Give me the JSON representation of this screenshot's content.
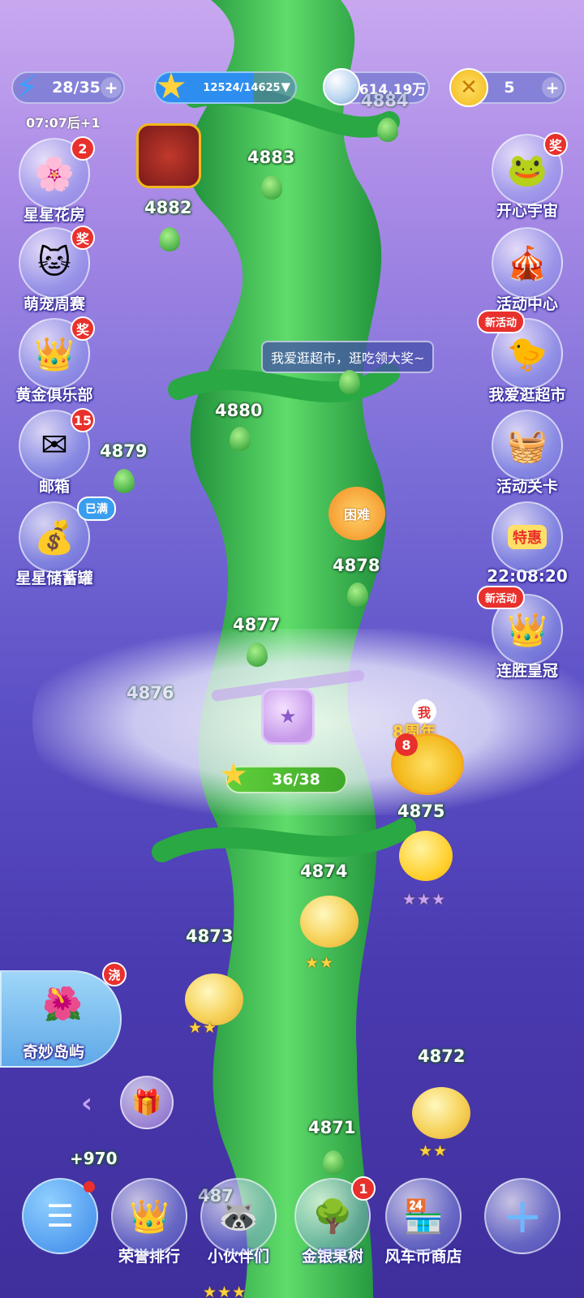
{
  "top_bar": {
    "lives": "28/35",
    "lives_timer": "07:07后+1",
    "stars_progress": "12524/14625",
    "silver": "614.19万",
    "coins": "5"
  },
  "left_menu": [
    {
      "label": "星星花房",
      "badge": "2"
    },
    {
      "label": "萌宠周赛",
      "badge": "奖"
    },
    {
      "label": "黄金俱乐部",
      "badge": "奖"
    },
    {
      "label": "邮箱",
      "badge": "15"
    },
    {
      "label": "星星储蓄罐",
      "badge": "已满"
    }
  ],
  "right_menu": [
    {
      "label": "开心宇宙",
      "badge": "奖"
    },
    {
      "label": "活动中心",
      "badge": ""
    },
    {
      "label": "我爱逛超市",
      "badge": "新活动"
    },
    {
      "label": "活动关卡",
      "badge": ""
    },
    {
      "label": "22:08:20",
      "badge": "特惠"
    },
    {
      "label": "连胜皇冠",
      "badge": "新活动"
    }
  ],
  "tooltip": "我爱逛超市，逛吃领大奖~",
  "levels": {
    "l4884": "4884",
    "l4883": "4883",
    "l4882": "4882",
    "l4880": "4880",
    "l4879": "4879",
    "l4878": "4878",
    "l4877": "4877",
    "l4876": "4876",
    "l4875": "4875",
    "l4874": "4874",
    "l4873": "4873",
    "l4872": "4872",
    "l4871": "4871",
    "l4870": "487"
  },
  "difficult_tag": "困难",
  "gate_progress": "36/38",
  "anniversary": {
    "me": "我",
    "text": "8周年",
    "number": "8"
  },
  "island": {
    "label": "奇妙岛屿",
    "badge": "浇"
  },
  "bonus_text": "+970",
  "bottom_bar": [
    {
      "label": ""
    },
    {
      "label": "荣誉排行"
    },
    {
      "label": "小伙伴们"
    },
    {
      "label": "金银果树",
      "badge": "1"
    },
    {
      "label": "风车币商店"
    },
    {
      "label": ""
    }
  ],
  "ratings": {
    "r4875": "★★★",
    "r4874": "★★",
    "r4873": "★★",
    "r4872": "★★"
  },
  "colors": {
    "accent_red": "#e8302c",
    "stalk_green": "#3fbf4f",
    "star_gold": "#ffd23d"
  }
}
